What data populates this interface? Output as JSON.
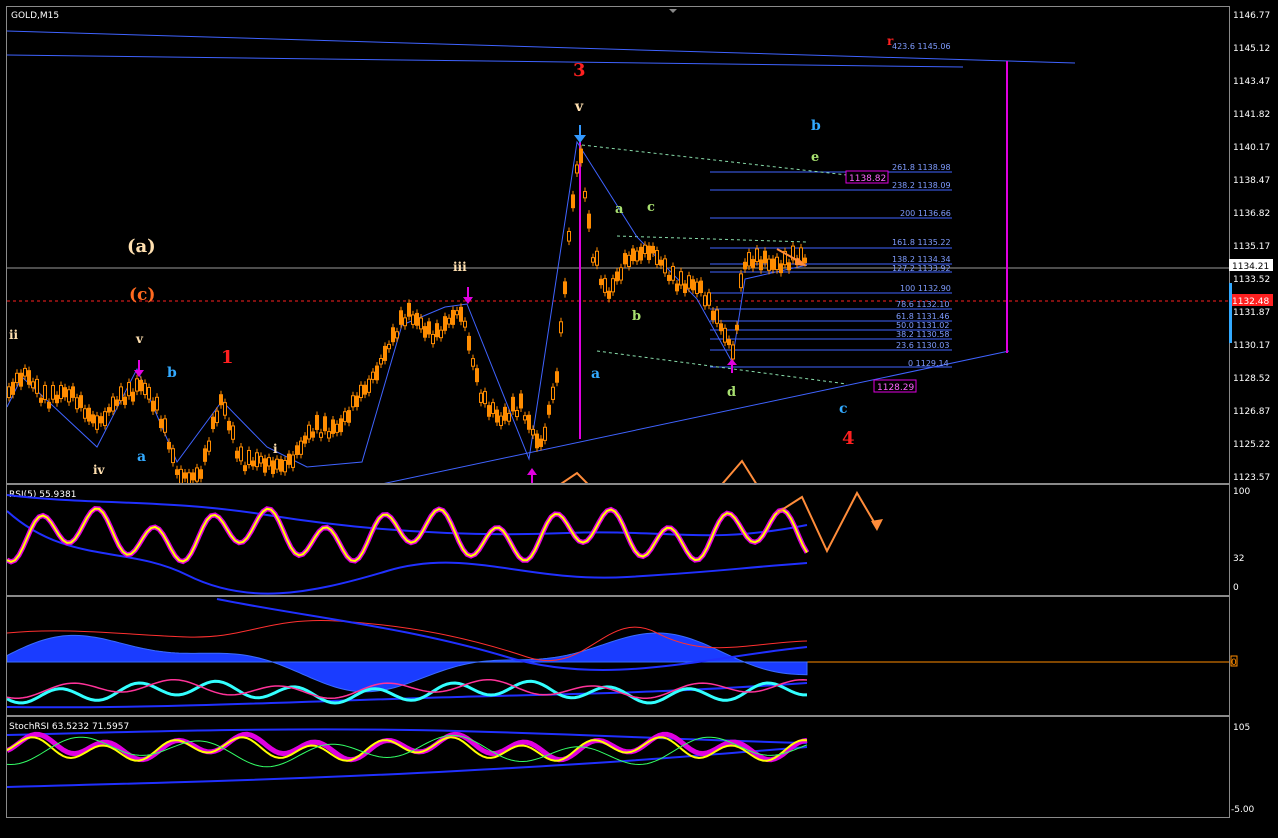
{
  "chart_title": "GOLD,M15",
  "price_axis": [
    "1146.77",
    "1145.12",
    "1143.47",
    "1141.82",
    "1140.17",
    "1138.47",
    "1136.82",
    "1135.17",
    "1133.52",
    "1131.87",
    "1130.17",
    "1128.52",
    "1126.87",
    "1125.22",
    "1123.57"
  ],
  "current_price": "1134.21",
  "red_price": "1132.48",
  "fib_levels": [
    "423.6 1145.06",
    "261.8 1138.98",
    "238.2 1138.09",
    "200 1136.66",
    "161.8 1135.22",
    "138.2 1134.34",
    "127.2 1133.92",
    "100 1132.90",
    "78.6 1132.10",
    "61.8 1131.46",
    "50.0 1131.02",
    "38.2 1130.58",
    "23.6 1130.03",
    "0 1129.14"
  ],
  "price_tags": [
    "1138.82",
    "1128.29"
  ],
  "wave_labels": {
    "big_a": "(a)",
    "big_c": "(c)",
    "ii": "ii",
    "iv": "iv",
    "v_left": "v",
    "i": "i",
    "iii": "iii",
    "v_top": "v",
    "a1": "a",
    "b1": "b",
    "one": "1",
    "three": "3",
    "four": "4",
    "g_a": "a",
    "g_c": "c",
    "g_b": "b",
    "g_d": "d",
    "g_e": "e",
    "c_a": "a",
    "c_b": "b",
    "c_c": "c",
    "r_mark": "r"
  },
  "indicators": {
    "rsi_title": "RSI(5) 55.9381",
    "rsi_ticks": [
      "100",
      "32",
      "0"
    ],
    "macd_tick": "0",
    "stoch_title": "StochRSI 63.5232 71.5957",
    "stoch_ticks": [
      "105",
      "-5.00"
    ]
  },
  "colors": {
    "bg": "#000000",
    "candle": "#ff8c00",
    "trendline": "#3f63ff",
    "magenta": "#e000e0",
    "fib": "#7f9cff",
    "yellow": "#ffff00",
    "cyan": "#33ffff",
    "orange_arrow": "#ff8c3a"
  }
}
